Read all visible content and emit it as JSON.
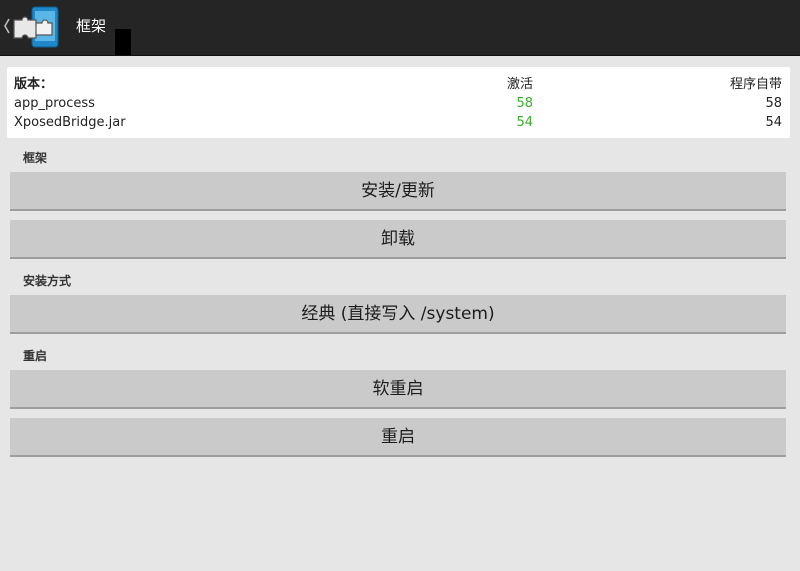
{
  "actionbar": {
    "title": "框架",
    "up_icon": "chevron-left-icon",
    "app_icon": "xposed-puzzle-icon"
  },
  "versions": {
    "header": {
      "label": "版本：",
      "active": "激活",
      "bundled": "程序自带"
    },
    "rows": [
      {
        "name": "app_process",
        "active": "58",
        "bundled": "58"
      },
      {
        "name": "XposedBridge.jar",
        "active": "54",
        "bundled": "54"
      }
    ],
    "active_color": "#3cab2e"
  },
  "sections": {
    "framework": {
      "label": "框架",
      "install_update": "安装/更新",
      "uninstall": "卸载"
    },
    "install_mode": {
      "label": "安装方式",
      "classic": "经典 (直接写入 /system)"
    },
    "reboot": {
      "label": "重启",
      "soft_reboot": "软重启",
      "reboot": "重启"
    }
  }
}
